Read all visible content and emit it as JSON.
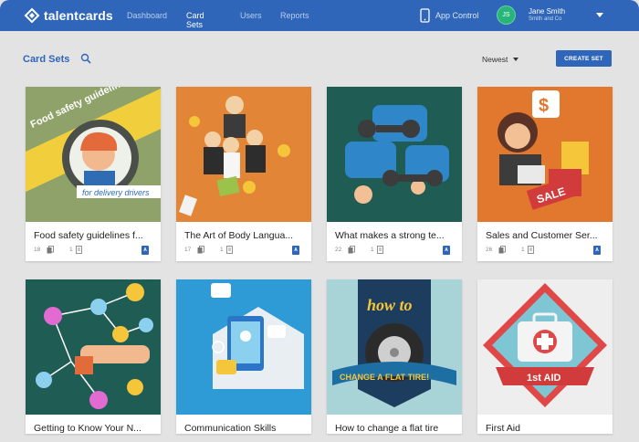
{
  "app": {
    "name": "talentcards"
  },
  "nav": {
    "items": [
      "Dashboard",
      "Card Sets",
      "Users",
      "Reports"
    ],
    "active": "Card Sets",
    "app_control": "App Control"
  },
  "user": {
    "initials": "JS",
    "name": "Jane Smith",
    "org": "Smith and Co"
  },
  "toolbar": {
    "title": "Card Sets",
    "sort": "Newest",
    "create": "CREATE SET"
  },
  "cards": [
    {
      "title": "Food safety guidelines f...",
      "cards": "18",
      "tests": "1",
      "badge": "A"
    },
    {
      "title": "The Art of Body Langua...",
      "cards": "17",
      "tests": "1",
      "badge": "A"
    },
    {
      "title": "What makes a strong te...",
      "cards": "22",
      "tests": "1",
      "badge": "A"
    },
    {
      "title": "Sales and Customer Ser...",
      "cards": "26",
      "tests": "1",
      "badge": "A"
    },
    {
      "title": "Getting to Know Your N...",
      "cards": "",
      "tests": "",
      "badge": ""
    },
    {
      "title": "Communication Skills",
      "cards": "",
      "tests": "",
      "badge": ""
    },
    {
      "title": "How to change a flat tire",
      "cards": "",
      "tests": "",
      "badge": ""
    },
    {
      "title": "First Aid",
      "cards": "",
      "tests": "",
      "badge": ""
    }
  ],
  "artwork": {
    "food_banner": "Food safety guidelines",
    "food_ribbon": "for delivery drivers",
    "tire_how": "how to",
    "tire_ribbon": "CHANGE A FLAT TIRE!",
    "sale": "SALE",
    "aid": "1st AID"
  },
  "colors": {
    "brand": "#2f66b9",
    "avatar": "#27b57a"
  }
}
